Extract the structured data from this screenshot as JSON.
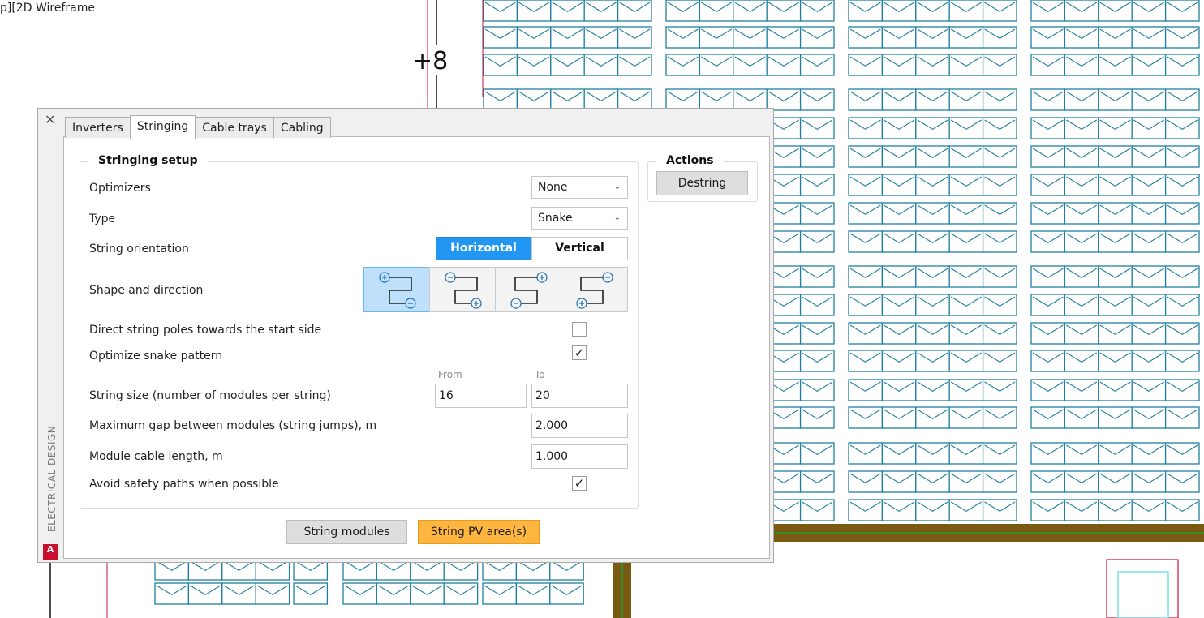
{
  "viewport": {
    "label": "p][2D Wireframe",
    "grid_marker": "+8"
  },
  "palette": {
    "side_title": "ELECTRICAL DESIGN",
    "logo_text": "A",
    "tabs": [
      {
        "label": "Inverters",
        "active": false
      },
      {
        "label": "Stringing",
        "active": true
      },
      {
        "label": "Cable trays",
        "active": false
      },
      {
        "label": "Cabling",
        "active": false
      }
    ]
  },
  "stringing_setup": {
    "title": "Stringing setup",
    "optimizers": {
      "label": "Optimizers",
      "value": "None"
    },
    "type": {
      "label": "Type",
      "value": "Snake"
    },
    "orientation": {
      "label": "String orientation",
      "options": [
        "Horizontal",
        "Vertical"
      ],
      "selected": "Horizontal"
    },
    "shape": {
      "label": "Shape and direction",
      "selected_index": 0
    },
    "direct_poles": {
      "label": "Direct string poles towards the start side",
      "checked": false
    },
    "optimize_snake": {
      "label": "Optimize snake pattern",
      "checked": true
    },
    "string_size": {
      "label": "String size (number of modules per string)",
      "from_label": "From",
      "to_label": "To",
      "from": "16",
      "to": "20"
    },
    "max_gap": {
      "label": "Maximum gap between modules (string jumps), m",
      "value": "2.000"
    },
    "cable_length": {
      "label": "Module cable length, m",
      "value": "1.000"
    },
    "avoid_paths": {
      "label": "Avoid safety paths when possible",
      "checked": true
    }
  },
  "actions": {
    "title": "Actions",
    "destring_label": "Destring"
  },
  "buttons": {
    "string_modules": "String modules",
    "string_pv_area": "String PV area(s)"
  },
  "colors": {
    "module_stroke": "#1f7f9e",
    "accent_blue": "#2196f3",
    "primary_orange": "#ffb640",
    "tray_brown": "#7a5a12",
    "tray_green": "#3b8a2a",
    "red_line": "#d0103a"
  }
}
